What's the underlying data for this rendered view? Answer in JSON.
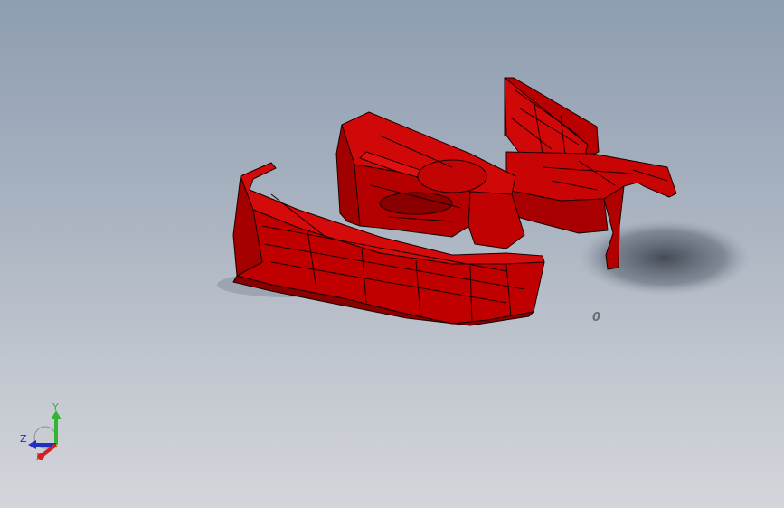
{
  "viewport": {
    "background_top": "#8e9db1",
    "background_bottom": "#d3d5da"
  },
  "model": {
    "part_color": "#c00000",
    "edge_color": "#1a0000",
    "shadow_color": "#5a6270"
  },
  "dimension_label": "0",
  "triad": {
    "x_label": "X",
    "y_label": "Y",
    "z_label": "Z",
    "x_color": "#d22020",
    "y_color": "#33b533",
    "z_color": "#2030c0"
  }
}
